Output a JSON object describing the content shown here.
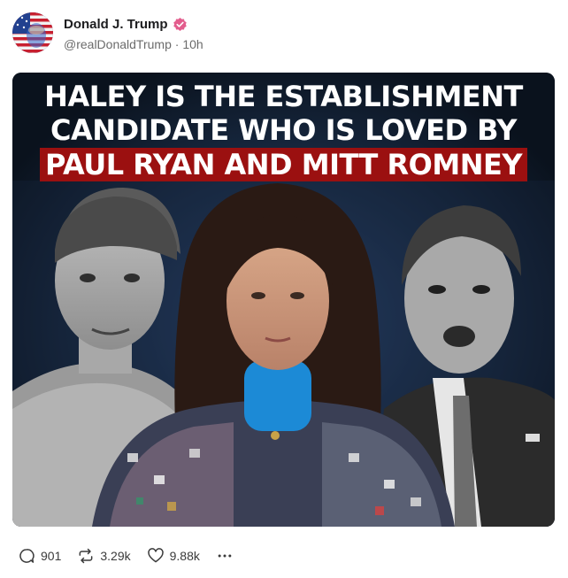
{
  "post": {
    "display_name": "Donald J. Trump",
    "handle": "@realDonaldTrump",
    "separator": "·",
    "time_ago": "10h",
    "verified_color": "#e35d8d",
    "media": {
      "headline_line1": "HALEY IS THE ESTABLISHMENT",
      "headline_line2": "CANDIDATE WHO IS LOVED BY",
      "headline_line3": "PAUL RYAN AND MITT ROMNEY",
      "highlight_color": "#9b1010"
    },
    "actions": {
      "replies": "901",
      "reposts": "3.29k",
      "likes": "9.88k",
      "more_icon": "ellipsis-icon"
    }
  }
}
